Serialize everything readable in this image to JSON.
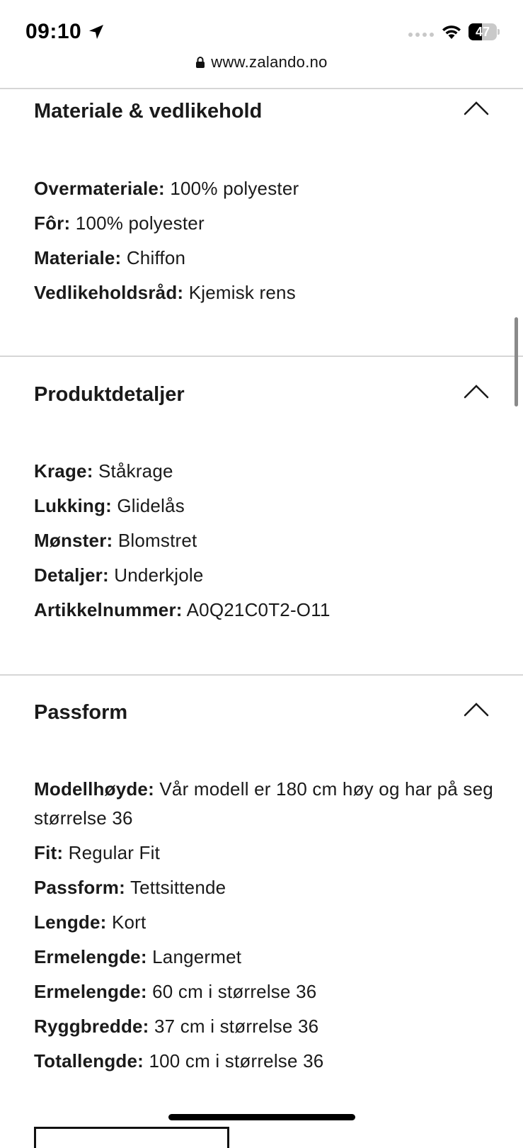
{
  "status_bar": {
    "time": "09:10",
    "battery": "47",
    "battery_level": 0.47
  },
  "url_bar": {
    "url": "www.zalando.no"
  },
  "sections": [
    {
      "title": "Materiale & vedlikehold",
      "expanded": true,
      "attributes": [
        {
          "key": "Overmateriale:",
          "value": "100% polyester"
        },
        {
          "key": "Fôr:",
          "value": "100% polyester"
        },
        {
          "key": "Materiale:",
          "value": "Chiffon"
        },
        {
          "key": "Vedlikeholdsråd:",
          "value": "Kjemisk rens"
        }
      ]
    },
    {
      "title": "Produktdetaljer",
      "expanded": true,
      "attributes": [
        {
          "key": "Krage:",
          "value": "Ståkrage"
        },
        {
          "key": "Lukking:",
          "value": "Glidelås"
        },
        {
          "key": "Mønster:",
          "value": "Blomstret"
        },
        {
          "key": "Detaljer:",
          "value": "Underkjole"
        },
        {
          "key": "Artikkelnummer:",
          "value": "A0Q21C0T2-O11"
        }
      ]
    },
    {
      "title": "Passform",
      "expanded": true,
      "attributes": [
        {
          "key": "Modellhøyde:",
          "value": "Vår modell er 180 cm høy og har på seg størrelse 36"
        },
        {
          "key": "Fit:",
          "value": "Regular Fit"
        },
        {
          "key": "Passform:",
          "value": "Tettsittende"
        },
        {
          "key": "Lengde:",
          "value": "Kort"
        },
        {
          "key": "Ermelengde:",
          "value": "Langermet"
        },
        {
          "key": "Ermelengde:",
          "value": "60 cm i størrelse 36"
        },
        {
          "key": "Ryggbredde:",
          "value": "37 cm i størrelse 36"
        },
        {
          "key": "Totallengde:",
          "value": "100 cm i størrelse 36"
        }
      ]
    }
  ],
  "icons": {
    "location": "location-arrow-icon",
    "signal": "cellular-signal-icon",
    "wifi": "wifi-icon",
    "lock": "lock-icon",
    "collapse": "chevron-up-icon"
  }
}
